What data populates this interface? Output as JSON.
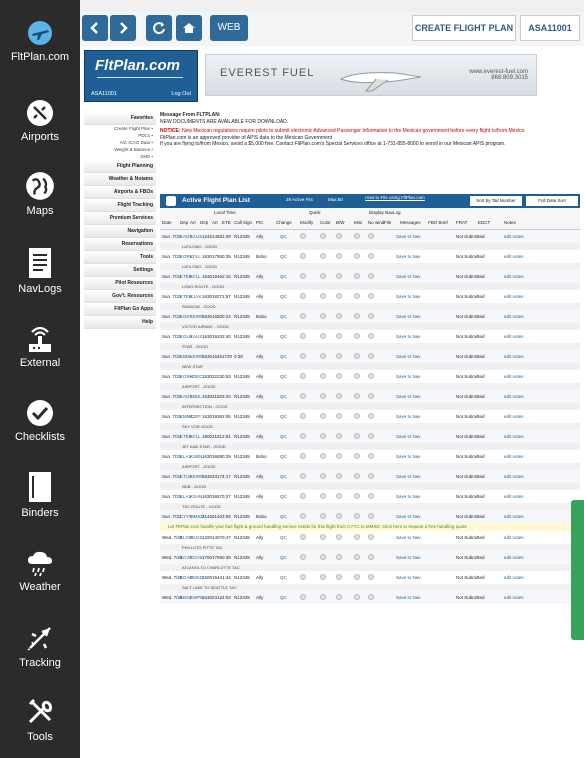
{
  "sidebar": {
    "items": [
      {
        "label": "FltPlan.com",
        "icon": "airplane-globe-icon"
      },
      {
        "label": "Airports",
        "icon": "airplane-circle-icon"
      },
      {
        "label": "Maps",
        "icon": "globe-icon"
      },
      {
        "label": "NavLogs",
        "icon": "document-icon"
      },
      {
        "label": "External",
        "icon": "wifi-router-icon"
      },
      {
        "label": "Checklists",
        "icon": "checkmark-icon"
      },
      {
        "label": "Binders",
        "icon": "binder-icon"
      },
      {
        "label": "Weather",
        "icon": "cloud-rain-icon"
      },
      {
        "label": "Tracking",
        "icon": "plane-tracking-icon"
      },
      {
        "label": "Tools",
        "icon": "wrench-screwdriver-icon"
      }
    ]
  },
  "toolbar": {
    "back_icon": "chevron-left-icon",
    "forward_icon": "chevron-right-icon",
    "refresh_icon": "refresh-icon",
    "home_icon": "home-icon",
    "web_label": "WEB",
    "create_flight_plan": "CREATE FLIGHT PLAN",
    "account_id": "ASA11001"
  },
  "logo": {
    "text": "FltPlan.com",
    "account": "ASA11001",
    "logout": "Log Out"
  },
  "banner": {
    "brand": "EVEREST FUEL",
    "url": "www.everest-fuel.com",
    "phone": "866.809.3015"
  },
  "leftnav": [
    {
      "label": "Favorites",
      "type": "head"
    },
    {
      "label": "Create Flight Plan •",
      "type": "sub"
    },
    {
      "label": "PDCs •",
      "type": "sub"
    },
    {
      "label": "A/C ICAO Data •",
      "type": "sub"
    },
    {
      "label": "Weight & Balance •",
      "type": "sub"
    },
    {
      "label": "SMS •",
      "type": "sub"
    },
    {
      "label": "Flight Planning",
      "type": "head"
    },
    {
      "label": "Weather & Notams",
      "type": "head"
    },
    {
      "label": "Airports & FBOs",
      "type": "head"
    },
    {
      "label": "Flight Tracking",
      "type": "head"
    },
    {
      "label": "Premium Services",
      "type": "head"
    },
    {
      "label": "Navigation",
      "type": "head"
    },
    {
      "label": "Reservations",
      "type": "head"
    },
    {
      "label": "Tools",
      "type": "head"
    },
    {
      "label": "Settings",
      "type": "head"
    },
    {
      "label": "Pilot Resources",
      "type": "head"
    },
    {
      "label": "Gov't. Resources",
      "type": "head"
    },
    {
      "label": "FltPlan Go Apps",
      "type": "head"
    },
    {
      "label": "Help",
      "type": "head"
    }
  ],
  "message": {
    "header": "Message From FLTPLAN:",
    "line1": "NEW DOCUMENTS ARE AVAILABLE FOR DOWNLOAD.",
    "notice_label": "NOTICE:",
    "notice": "New Mexican regulations require pilots to submit electronic Advanced Passenger Information to the Mexican government before every flight to/from Mexico.",
    "line3": "FltPlan.com is an approved provider of APIS data to the Mexican Government",
    "line4": "If you are flying to/from Mexico, avoid a $5,000 fine. Contact FltPlan.com's Special Services office at 1-731-855-8000 to enroll in our Mexican APIS program."
  },
  "flight_list": {
    "title": "Active Flight Plan List",
    "active_count": "29 Active Fits",
    "max": "Max:50",
    "how_to_file": "How to File using FltPlan.com",
    "sort_tail": "Sort by Tail Number",
    "sort_date": "Full Date Sort",
    "local_time": "Local Time",
    "quick": "Quick",
    "display_navlog": "Display NavLog",
    "columns": [
      "Date",
      "Dep",
      "Arr",
      "Dep",
      "Arr",
      "ETE",
      "Call Sign",
      "PIC",
      "Change",
      "Modify",
      "Color",
      "B/W",
      "Mini",
      "No wind",
      "File",
      "Messages",
      "FBO Brief",
      "FRAT",
      "EDCT",
      "Notes"
    ],
    "status": "Not Submitted",
    "qc": "QC",
    "edit_notes": "edit notes",
    "messages": "Save\nto\nNav",
    "sub_prefix": "notes ------>",
    "promo": "Let FltPlan.com handle your fuel flight & ground handling service needs for this flight from CYYC to MMSD. Click here to request a free handling quote",
    "flights": [
      {
        "date": "Sun. 7/31",
        "dep": "KAGS",
        "arr": "KAUS",
        "d": "1245",
        "a": "1458",
        "ete": "1:09",
        "cs": "N12345",
        "pic": "Ally",
        "note": "LAT/LONG - GOOD"
      },
      {
        "date": "Sun. 7/31",
        "dep": "KORL",
        "arr": "KFLL",
        "d": "1630",
        "a": "1755",
        "ete": "0:35",
        "cs": "N12345",
        "pic": "Bobo",
        "note": "LAT/LONG - GOOD"
      },
      {
        "date": "Sun. 7/31",
        "dep": "KTEB",
        "arr": "KFLL",
        "d": "1630",
        "a": "1945",
        "ete": "2:15",
        "cs": "N12345",
        "pic": "Ally",
        "note": "LONG ROUTE - GOOD"
      },
      {
        "date": "Sun. 7/31",
        "dep": "KTEB",
        "arr": "KJAX",
        "d": "1630",
        "a": "1827",
        "ete": "1:57",
        "cs": "N12345",
        "pic": "Ally",
        "note": "RANDOM - GOOD"
      },
      {
        "date": "Sun. 7/31",
        "dep": "KGKY",
        "arr": "KEWR",
        "d": "1630",
        "a": "1650",
        "ete": "0:24",
        "cs": "N12345",
        "pic": "Bobo",
        "note": "VICTOR AIRWAY - GOOD"
      },
      {
        "date": "Sun. 7/31",
        "dep": "KGLD",
        "arr": "KAUS",
        "d": "1630",
        "a": "1910",
        "ete": "2:40",
        "cs": "N12345",
        "pic": "Ally",
        "note": "STAR - GOOD"
      },
      {
        "date": "Sun. 7/31",
        "dep": "KBDL",
        "arr": "KEWR",
        "d": "1630",
        "a": "1645",
        "ete": "1720",
        "cs": "0:38",
        "pic": "Ally",
        "note": "NEW STAR"
      },
      {
        "date": "Sun. 7/31",
        "dep": "KOSH",
        "arr": "KDEC",
        "d": "1630",
        "a": "2223",
        "ete": "0:53",
        "cs": "N12345",
        "pic": "Ally",
        "note": "AIRPORT - GOOD"
      },
      {
        "date": "Sun. 7/31",
        "dep": "KAGS",
        "arr": "KBDL",
        "d": "1630",
        "a": "2150",
        "ete": "3:20",
        "cs": "N12345",
        "pic": "Ally",
        "note": "INTERSECTION - GOOD"
      },
      {
        "date": "Sun. 7/31",
        "dep": "KMMC",
        "arr": "KJEF",
        "d": "1630",
        "a": "1936",
        "ete": "2:06",
        "cs": "N12345",
        "pic": "Ally",
        "note": "SKY VOR GOOD"
      },
      {
        "date": "Sun. 7/31",
        "dep": "KTEB",
        "arr": "KFLL",
        "d": "1900",
        "a": "2151",
        "ete": "2:51",
        "cs": "N12345",
        "pic": "Ally",
        "note": "JET AND STAR - GOOD"
      },
      {
        "date": "Sun. 7/31",
        "dep": "KLAX",
        "arr": "KSBN",
        "d": "1630",
        "a": "1659",
        "ete": "0:29",
        "cs": "N12345",
        "pic": "Bobo",
        "note": "AIRPORT - GOOD"
      },
      {
        "date": "Sun. 7/31",
        "dep": "KTUS",
        "arr": "KEWR",
        "d": "1630",
        "a": "2317",
        "ete": "4:17",
        "cs": "N12345",
        "pic": "Ally",
        "note": "NDB - GOOD"
      },
      {
        "date": "Sun. 7/31",
        "dep": "KLAX",
        "arr": "KSAN",
        "d": "1630",
        "a": "1657",
        "ete": "0:27",
        "cs": "N12345",
        "pic": "Ally",
        "note": "TEC ROUTE - GOOD"
      },
      {
        "date": "Sun. 7/31",
        "dep": "CYYC",
        "arr": "MMSD",
        "d": "2145",
        "a": "0140",
        "ete": "3:55",
        "cs": "N12345",
        "pic": "Bobo",
        "note": ""
      },
      {
        "date": "Wed. 7/25",
        "dep": "KLGW",
        "arr": "KAGS",
        "d": "1320",
        "a": "1407",
        "ete": "0:47",
        "cs": "N12345",
        "pic": "Ally",
        "note": "PHILLUTO PITTS TAC"
      },
      {
        "date": "Wed. 7/25",
        "dep": "KCVG",
        "arr": "KCHS",
        "d": "1700",
        "a": "1759",
        "ete": "0:39",
        "cs": "N12345",
        "pic": "Ally",
        "note": "ATLANTA TO CHARLOTTE TAC"
      },
      {
        "date": "Wed. 7/25",
        "dep": "KGAD",
        "arr": "KMSD",
        "d": "1500",
        "a": "1544",
        "ete": "1:44",
        "cs": "N12345",
        "pic": "Ally",
        "note": "SALT LAKE TO SEATTLE TAC"
      },
      {
        "date": "Wed. 7/25",
        "dep": "KBSZ",
        "arr": "KWPB",
        "d": "1630",
        "a": "2312",
        "ete": "4:02",
        "cs": "N12345",
        "pic": "Ally",
        "note": ""
      }
    ]
  }
}
